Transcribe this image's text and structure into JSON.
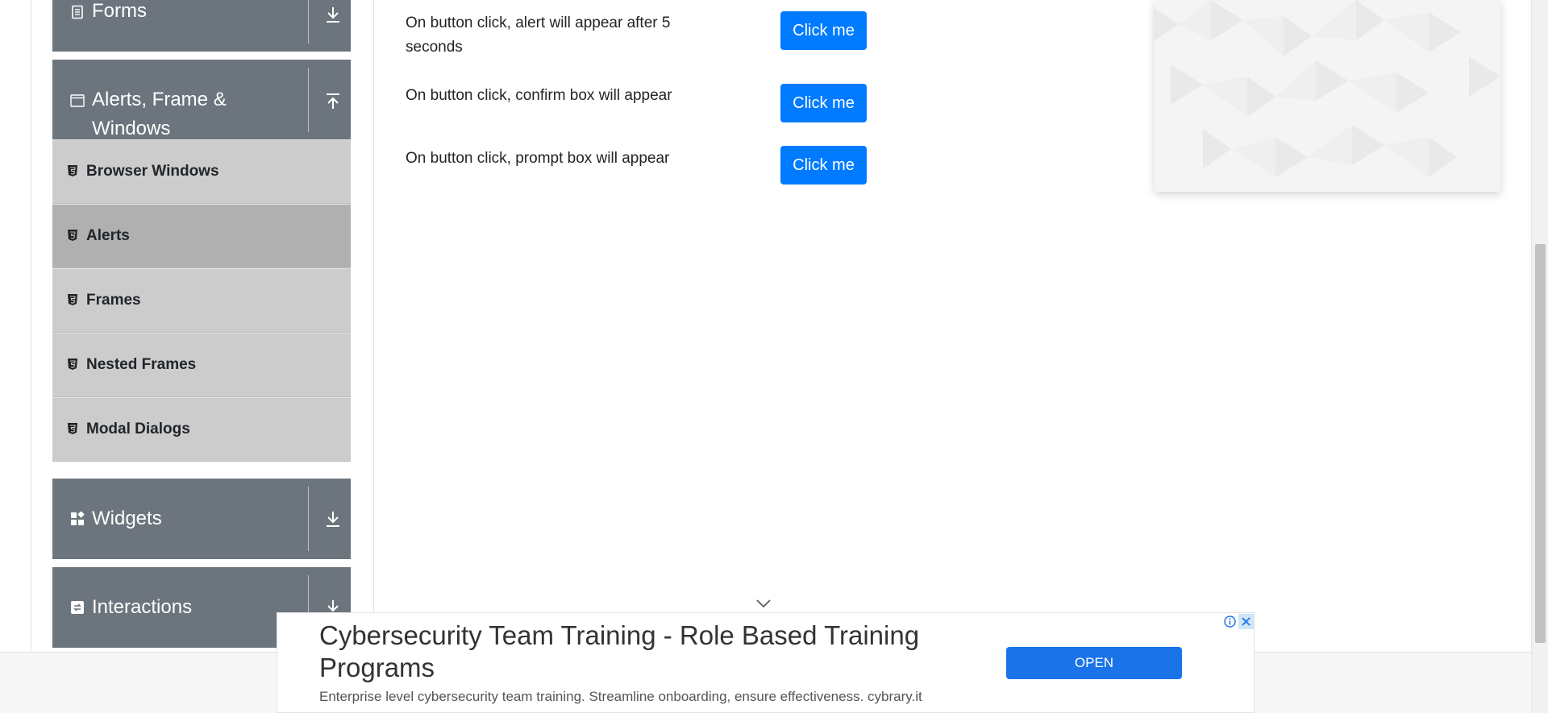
{
  "sidebar": {
    "forms": {
      "label": "Forms"
    },
    "alerts_group": {
      "label_line1": "Alerts, Frame &",
      "label_line2": "Windows"
    },
    "items": [
      {
        "label": "Browser Windows",
        "active": false
      },
      {
        "label": "Alerts",
        "active": true
      },
      {
        "label": "Frames",
        "active": false
      },
      {
        "label": "Nested Frames",
        "active": false
      },
      {
        "label": "Modal Dialogs",
        "active": false
      }
    ],
    "widgets": {
      "label": "Widgets"
    },
    "interactions": {
      "label": "Interactions"
    }
  },
  "main": {
    "rows": [
      {
        "text_line1": "On button click, alert will appear after 5",
        "text_line2": "seconds",
        "button": "Click me"
      },
      {
        "text": "On button click, confirm box will appear",
        "button": "Click me"
      },
      {
        "text": "On button click, prompt box will appear",
        "button": "Click me"
      }
    ]
  },
  "ad": {
    "title": "Cybersecurity Team Training - Role Based Training Programs",
    "description": "Enterprise level cybersecurity team training. Streamline onboarding, ensure effectiveness. cybrary.it",
    "button": "OPEN"
  },
  "colors": {
    "sidebar_header": "#6c757d",
    "sidebar_item": "#cccccc",
    "sidebar_item_active": "#b0b0b0",
    "primary_button": "#007bff",
    "ad_button": "#1a73e8"
  },
  "icons": {
    "forms": "document-icon",
    "alerts_group": "window-icon",
    "items": "html5-icon",
    "widgets": "widgets-icon",
    "interactions": "interactions-icon",
    "collapsed": "download-arrow-icon",
    "expanded": "upload-arrow-icon"
  }
}
